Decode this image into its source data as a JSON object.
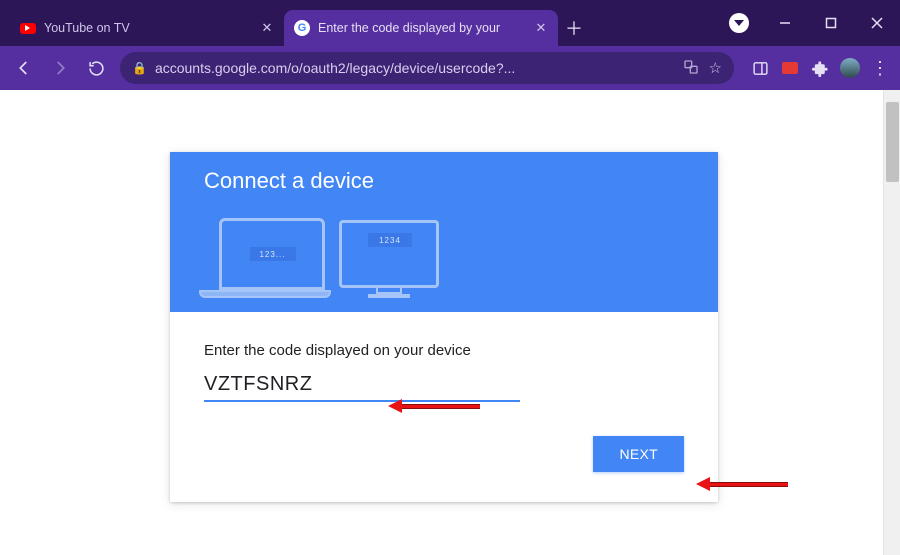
{
  "browser": {
    "tabs": [
      {
        "title": "YouTube on TV",
        "favicon": "youtube-icon"
      },
      {
        "title": "Enter the code displayed by your",
        "favicon": "google-icon"
      }
    ],
    "active_tab_index": 1,
    "url": "accounts.google.com/o/oauth2/legacy/device/usercode?..."
  },
  "page": {
    "hero_title": "Connect a device",
    "hero_badge_left": "123...",
    "hero_badge_right": "1234",
    "prompt": "Enter the code displayed on your device",
    "code_value": "VZTFSNRZ",
    "next_button": "NEXT"
  }
}
